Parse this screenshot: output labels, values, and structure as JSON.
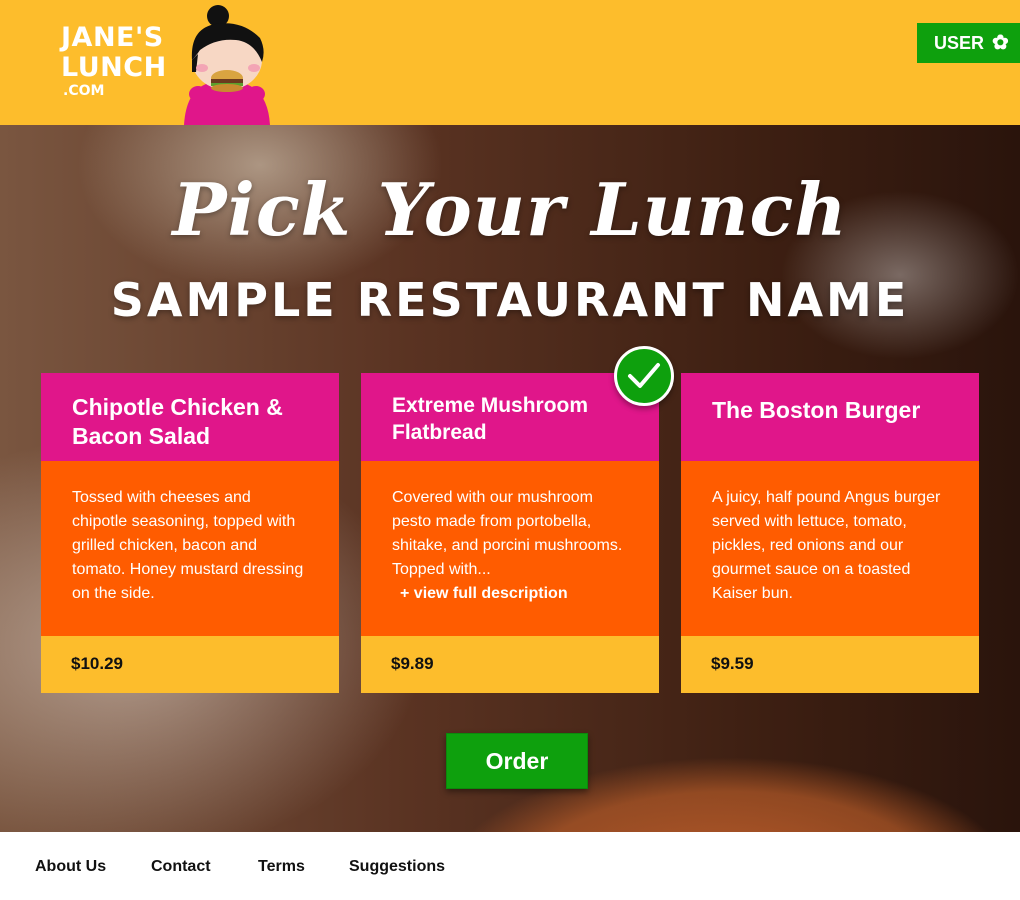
{
  "header": {
    "logo_line1": "JANE'S",
    "logo_line2": "LUNCH",
    "logo_line3": ".COM",
    "user_label": "USER",
    "user_icon": "gear-icon"
  },
  "hero": {
    "title": "Pick Your Lunch",
    "restaurant_name": "SAMPLE RESTAURANT NAME"
  },
  "menu": {
    "items": [
      {
        "name": "Chipotle Chicken & Bacon Salad",
        "description": "Tossed with cheeses and chipotle seasoning, topped with grilled chicken, bacon and tomato. Honey mustard dressing on the side.",
        "price": "$10.29",
        "selected": false
      },
      {
        "name": "Extreme Mushroom Flatbread",
        "description": "Covered with our mushroom pesto made from portobella, shitake, and porcini mushrooms. Topped with...",
        "view_more": "+ view full description",
        "price": "$9.89",
        "selected": true
      },
      {
        "name": "The Boston Burger",
        "description": "A juicy, half pound Angus burger served with lettuce, tomato, pickles, red onions and our gourmet sauce on a toasted Kaiser bun.",
        "price": "$9.59",
        "selected": false
      }
    ]
  },
  "order_label": "Order",
  "footer": {
    "links": [
      "About Us",
      "Contact",
      "Terms",
      "Suggestions"
    ]
  },
  "colors": {
    "header_bg": "#fdbd2c",
    "card_head": "#e0168a",
    "card_body": "#ff5c00",
    "card_foot": "#fdbd2c",
    "accent_green": "#0ea00d"
  }
}
